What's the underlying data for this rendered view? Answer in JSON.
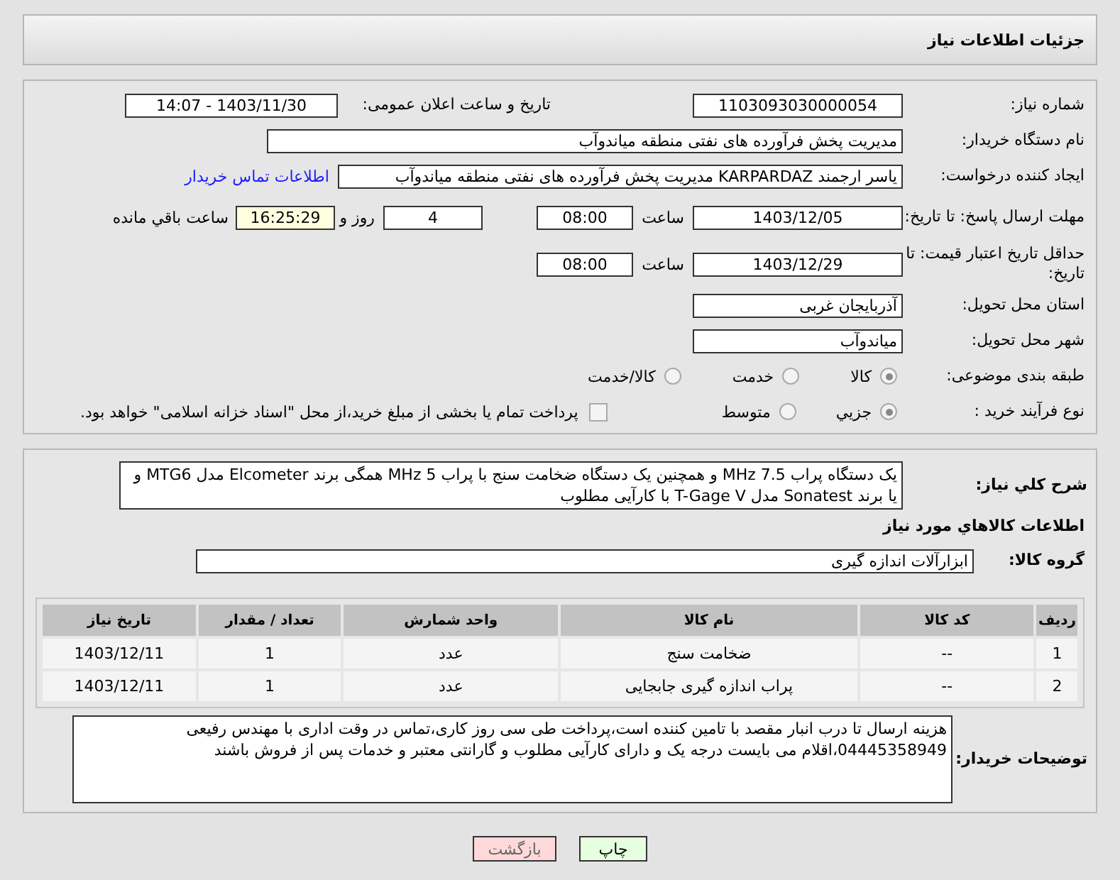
{
  "page_title": "جزئیات اطلاعات نیاز",
  "need_number": {
    "label": "شماره نیاز:",
    "value": "1103093030000054"
  },
  "announce": {
    "label": "تاریخ و ساعت اعلان عمومی:",
    "value": "1403/11/30 - 14:07"
  },
  "buyer_org": {
    "label": "نام دستگاه خریدار:",
    "value": "مدیریت پخش فرآورده های نفتی منطقه میاندوآب"
  },
  "requester": {
    "label": "ایجاد کننده درخواست:",
    "value": "یاسر ارجمند KARPARDAZ مدیریت پخش فرآورده های نفتی منطقه میاندوآب",
    "link": "اطلاعات تماس خریدار"
  },
  "reply_deadline": {
    "label": "مهلت ارسال پاسخ: تا تاریخ:",
    "date": "1403/12/05",
    "time_label": "ساعت",
    "time": "08:00",
    "days": "4",
    "days_label": "روز و",
    "remaining": "16:25:29",
    "remaining_label": "ساعت باقي مانده"
  },
  "price_validity": {
    "label": "حداقل تاریخ اعتبار قیمت: تا تاریخ:",
    "date": "1403/12/29",
    "time_label": "ساعت",
    "time": "08:00"
  },
  "province": {
    "label": "استان محل تحویل:",
    "value": "آذربایجان غربی"
  },
  "city": {
    "label": "شهر محل تحویل:",
    "value": "میاندوآب"
  },
  "category": {
    "label": "طبقه بندی موضوعی:",
    "options": [
      {
        "label": "کالا",
        "selected": true
      },
      {
        "label": "خدمت",
        "selected": false
      },
      {
        "label": "کالا/خدمت",
        "selected": false
      }
    ]
  },
  "purchase_type": {
    "label": "نوع فرآیند خرید :",
    "options": [
      {
        "label": "جزیي",
        "selected": true
      },
      {
        "label": "متوسط",
        "selected": false
      }
    ],
    "treasury": {
      "checked": false,
      "label": "پرداخت تمام یا بخشی از مبلغ خرید،از محل \"اسناد خزانه اسلامی\" خواهد بود."
    }
  },
  "description": {
    "label": "شرح کلي نیاز:",
    "value": "یک دستگاه پراب MHz 7.5 و همچنین یک دستگاه ضخامت سنج با پراب MHz 5 همگی برند Elcometer مدل MTG6 و یا برند Sonatest مدل T-Gage V با کارآیی مطلوب"
  },
  "goods_heading": "اطلاعات کالاهاي مورد نیاز",
  "goods_group": {
    "label": "گروه کالا:",
    "value": "ابزارآلات اندازه گیری"
  },
  "table": {
    "columns": [
      "ردیف",
      "کد کالا",
      "نام کالا",
      "واحد شمارش",
      "تعداد / مقدار",
      "تاریخ نیاز"
    ],
    "rows": [
      [
        "1",
        "--",
        "ضخامت سنج",
        "عدد",
        "1",
        "1403/12/11"
      ],
      [
        "2",
        "--",
        "پراب اندازه گیری جابجایی",
        "عدد",
        "1",
        "1403/12/11"
      ]
    ]
  },
  "buyer_notes": {
    "label": "توضیحات خریدار:",
    "value": "هزینه ارسال تا درب انبار مقصد با تامین کننده است،پرداخت طی سی روز کاری،تماس در وقت اداری با مهندس رفیعی 04445358949،اقلام می بایست درجه یک و دارای کارآیی مطلوب و گارانتی معتبر و خدمات پس از فروش باشند"
  },
  "buttons": [
    {
      "label": "چاپ",
      "kind": "print"
    },
    {
      "label": "بازگشت",
      "kind": "back"
    }
  ]
}
